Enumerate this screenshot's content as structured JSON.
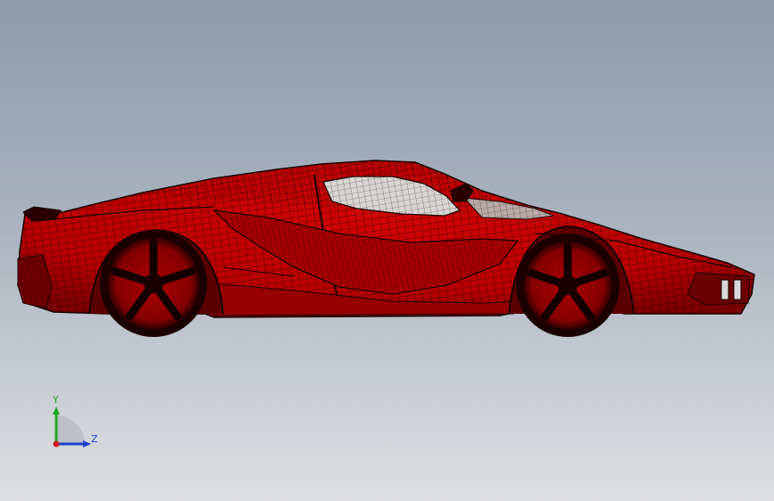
{
  "viewport": {
    "background_top": "#8d9aab",
    "background_bottom": "#dedfe1"
  },
  "model": {
    "body_color": "#c40000",
    "mesh_color": "#1a0000",
    "glass_color": "#d9d4d4",
    "display_style": "wireframe-shaded"
  },
  "triad": {
    "y_label": "Y",
    "z_label": "Z",
    "y_color": "#1ea81e",
    "z_color": "#1e3fd0",
    "x_color": "#d01818"
  }
}
